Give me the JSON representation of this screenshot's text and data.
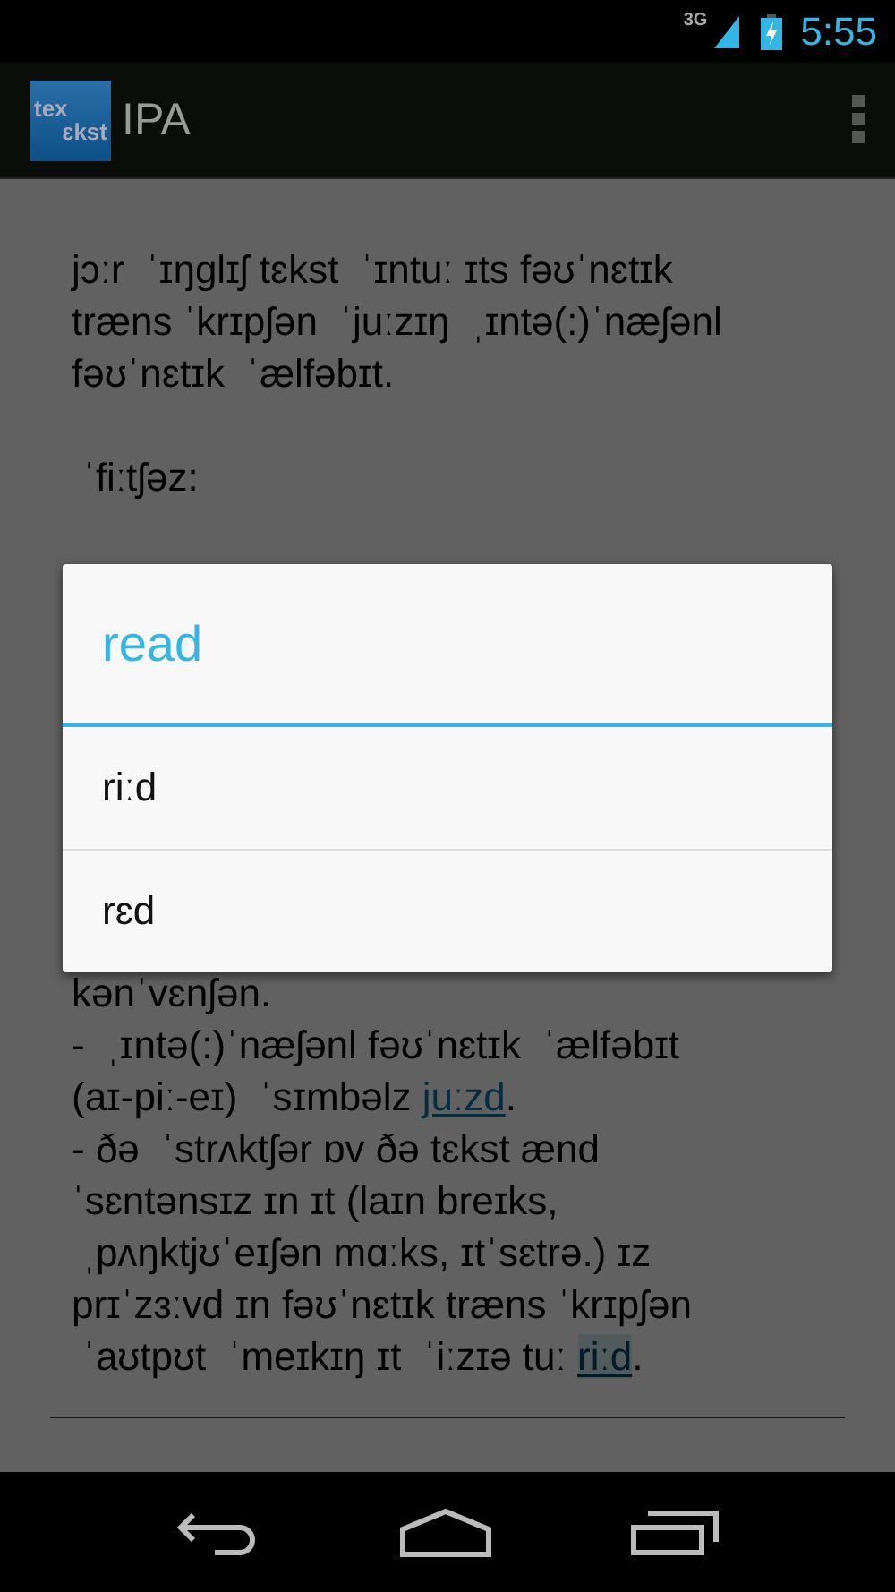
{
  "status_bar": {
    "network": "3G",
    "time": "5:55"
  },
  "action_bar": {
    "logo_lines": [
      "tex",
      "ɛkst"
    ],
    "title": "IPA"
  },
  "document": {
    "top_paragraphs": [
      {
        "kind": "text",
        "lines": [
          [
            {
              "kind": "text",
              "text": "jɔːr  ˈɪŋglɪʃ tɛkst  ˈɪntuː ɪts fəʊˈnɛtɪk"
            }
          ],
          [
            {
              "kind": "text",
              "text": "træns ˈkrɪpʃən  ˈjuːzɪŋ  ˌɪntə(:)ˈnæʃənl"
            }
          ],
          [
            {
              "kind": "text",
              "text": "fəʊˈnɛtɪk  ˈælfəbɪt."
            }
          ]
        ]
      },
      {
        "kind": "text",
        "lines": [
          [
            {
              "kind": "text",
              "text": " ˈfiːtʃəz:"
            }
          ]
        ]
      }
    ],
    "bottom_paragraphs": [
      {
        "kind": "text",
        "lines": [
          [
            {
              "kind": "text",
              "text": "kənˈvɛnʃən."
            }
          ],
          [
            {
              "kind": "text",
              "text": "-  ˌɪntə(:)ˈnæʃənl fəʊˈnɛtɪk  ˈælfəbɪt"
            }
          ],
          [
            {
              "kind": "text",
              "text": "(aɪ-piː-eɪ)  ˈsɪmbəlz "
            },
            {
              "kind": "link",
              "text": "juːzd",
              "selected": false
            },
            {
              "kind": "text",
              "text": "."
            }
          ],
          [
            {
              "kind": "text",
              "text": "- ðə  ˈstrʌktʃər ɒv ðə tɛkst ænd"
            }
          ],
          [
            {
              "kind": "text",
              "text": "ˈsɛntənsɪz ɪn ɪt (laɪn breɪks,"
            }
          ],
          [
            {
              "kind": "text",
              "text": " ˌpʌŋktjʊˈeɪʃən mɑːks, ɪtˈsɛtrə.) ɪz"
            }
          ],
          [
            {
              "kind": "text",
              "text": "prɪˈzɜːvd ɪn fəʊˈnɛtɪk træns ˈkrɪpʃən"
            }
          ],
          [
            {
              "kind": "text",
              "text": " ˈaʊtpʊt  ˈmeɪkɪŋ ɪt  ˈiːzɪə tuː "
            },
            {
              "kind": "link",
              "text": "riːd",
              "selected": true
            },
            {
              "kind": "text",
              "text": "."
            }
          ]
        ]
      }
    ]
  },
  "dialog": {
    "title": "read",
    "options": [
      {
        "label": "riːd"
      },
      {
        "label": "rɛd"
      }
    ]
  }
}
